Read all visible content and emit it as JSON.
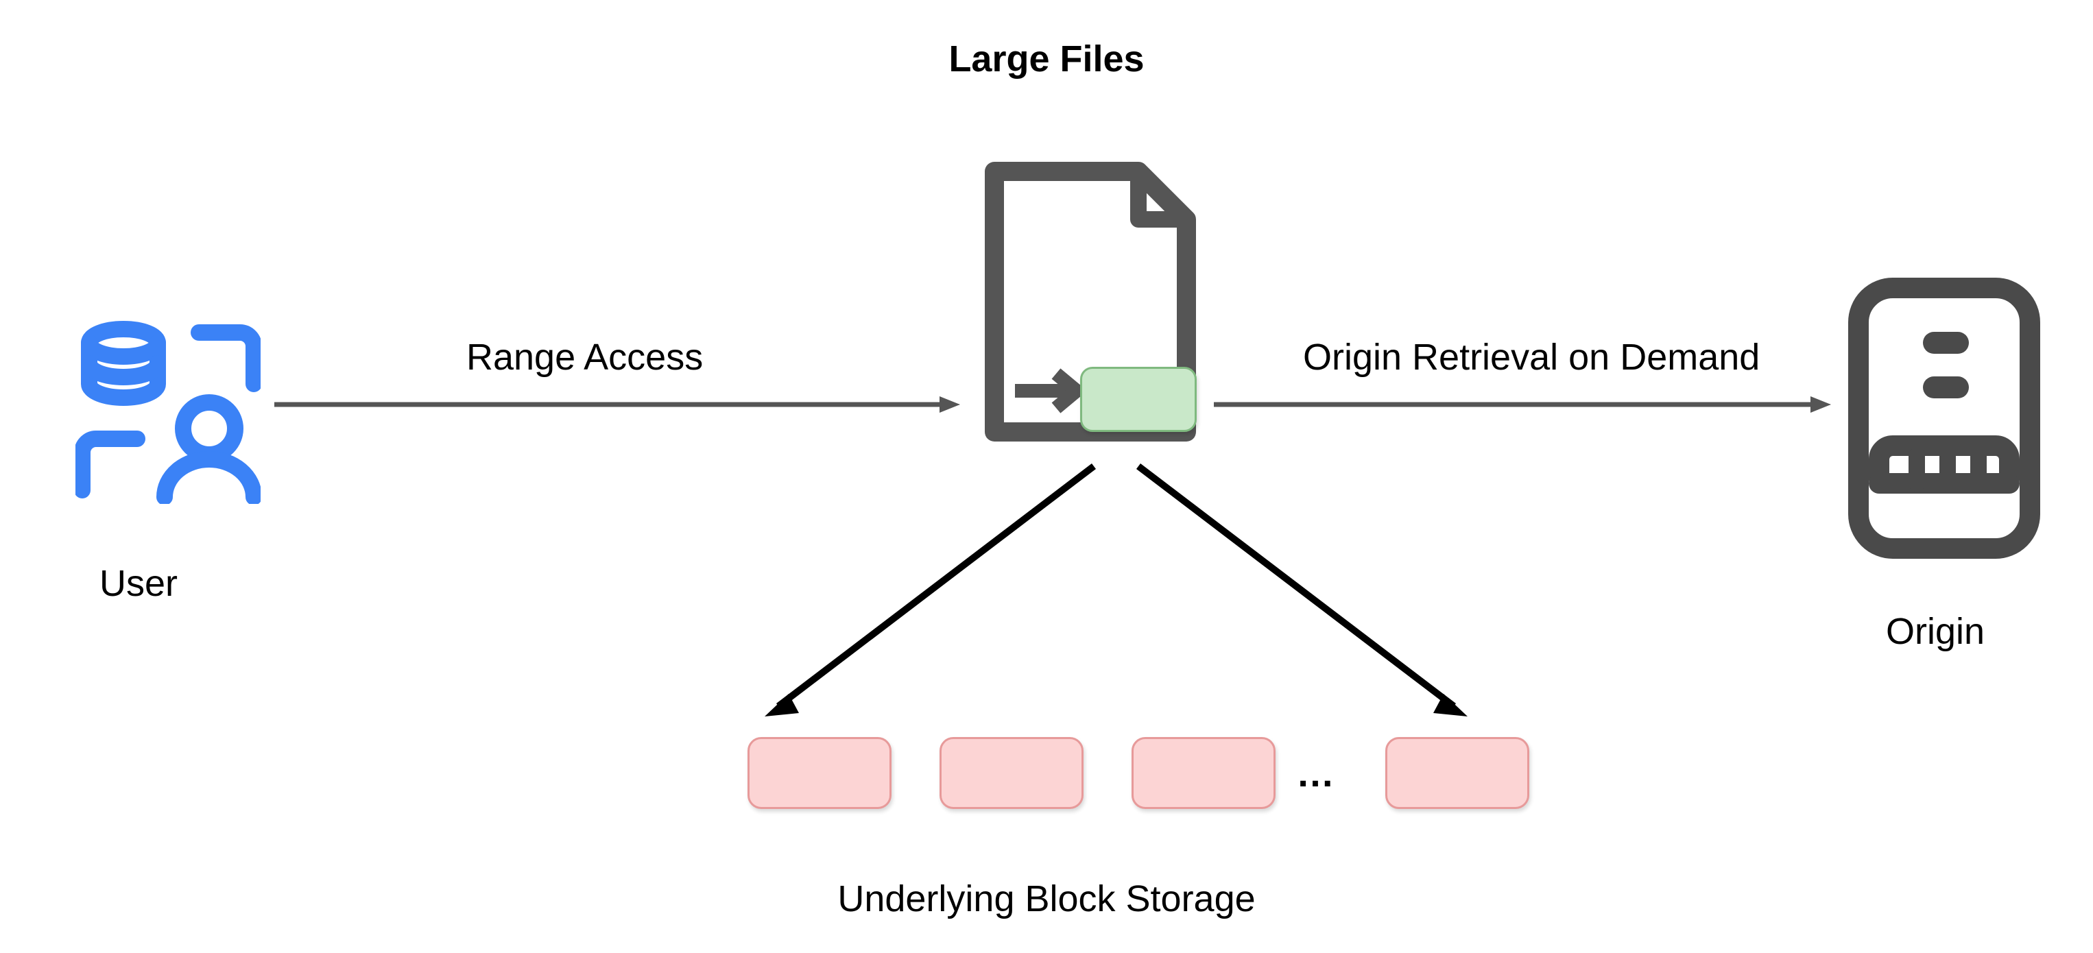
{
  "diagram": {
    "title_top": "Large Files",
    "title_bottom": "Underlying Block Storage",
    "user_label": "User",
    "origin_label": "Origin",
    "range_access_label": "Range Access",
    "origin_retrieval_label": "Origin Retrieval on Demand",
    "ellipsis": "…",
    "colors": {
      "user_icon": "#3b82f6",
      "file_icon_stroke": "#555555",
      "origin_icon_stroke": "#4a4a4a",
      "block_fill": "#fcd4d4",
      "block_border": "#e79a9a",
      "green_block_fill": "#c9e8c9",
      "green_block_border": "#7fb97f",
      "arrow": "#555555",
      "dark_arrow": "#000000"
    }
  }
}
